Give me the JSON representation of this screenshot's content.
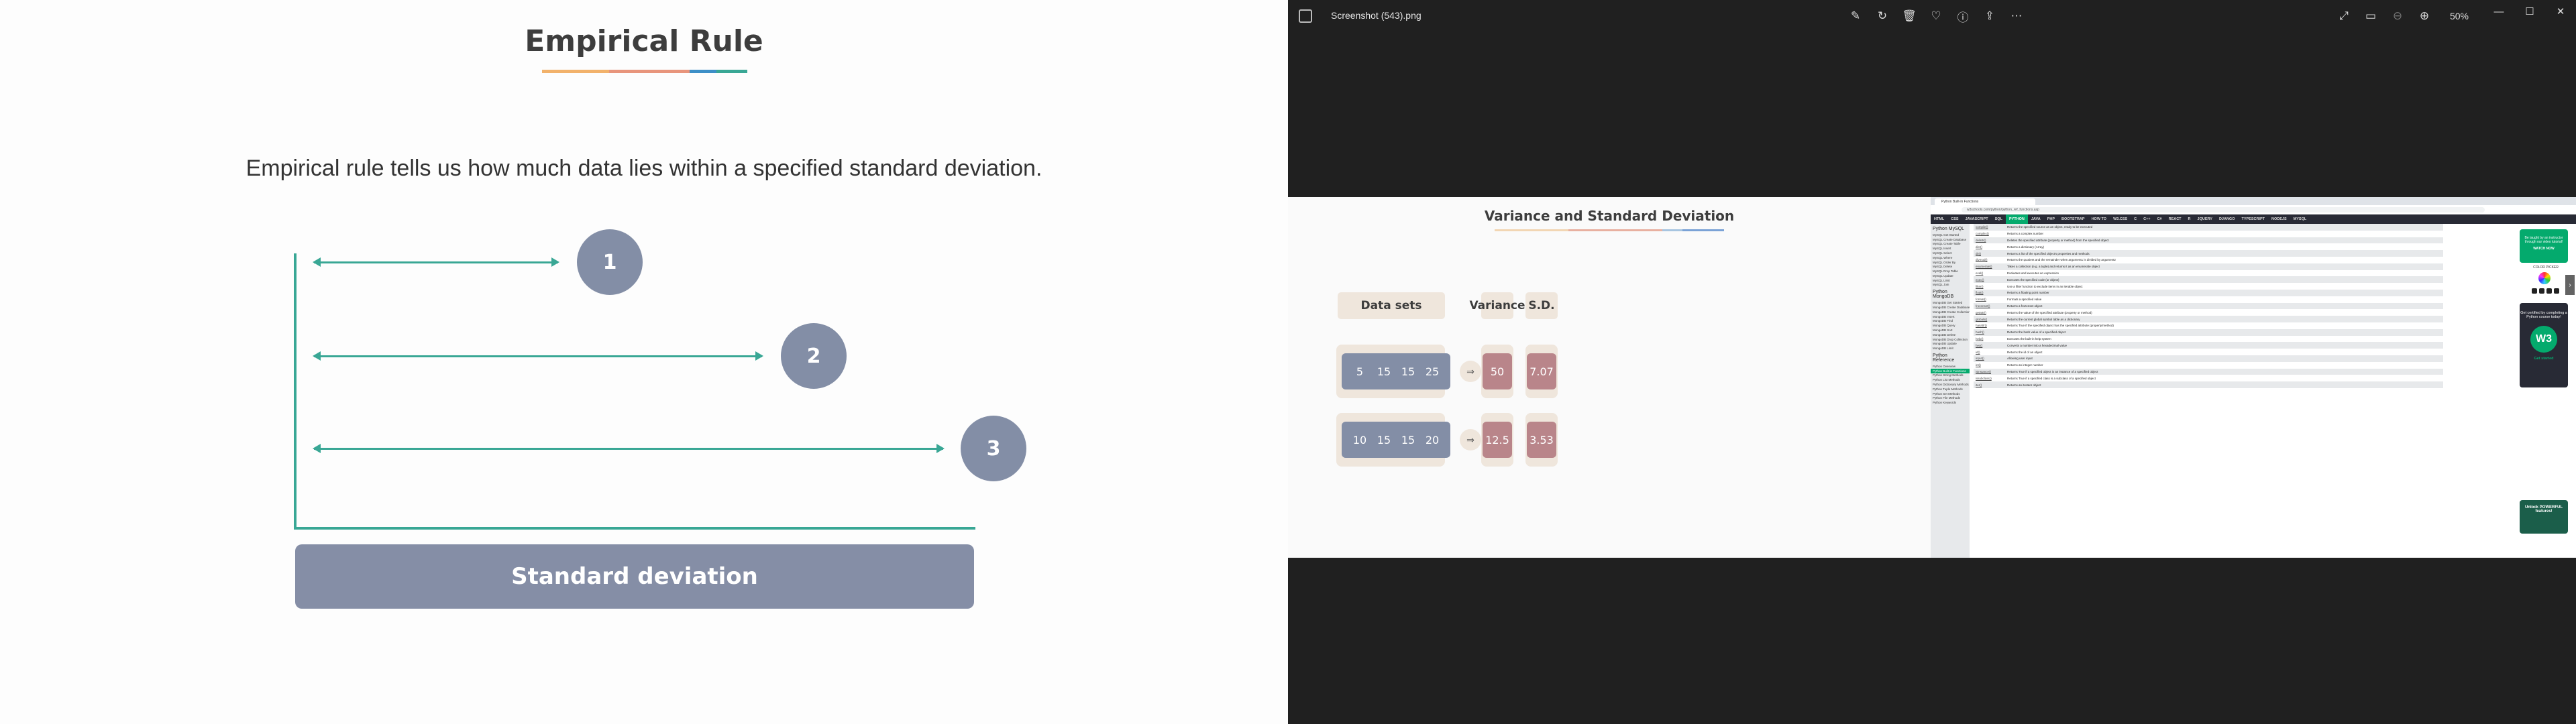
{
  "left_slide": {
    "title": "Empirical Rule",
    "subtitle": "Empirical rule tells us how much data lies within a specified standard deviation.",
    "circles": [
      "1",
      "2",
      "3"
    ],
    "box_label": "Standard deviation",
    "accent_colors": [
      "#f2b26b",
      "#e87a6c",
      "#3d8fc7",
      "#39a795"
    ]
  },
  "viewer": {
    "file_name": "Screenshot (543).png",
    "zoom": "50%",
    "toolbar_icons": [
      "edit-icon",
      "rotate-icon",
      "delete-icon",
      "favorite-icon",
      "info-icon",
      "share-icon",
      "more-icon"
    ],
    "right_icons": [
      "expand-icon",
      "slideshow-icon",
      "zoom-out-icon",
      "zoom-in-icon"
    ]
  },
  "inner_slide": {
    "title": "Variance and Standard Deviation",
    "headers": {
      "data_sets": "Data sets",
      "variance": "Variance",
      "sd": "S.D."
    },
    "rows": [
      {
        "values": [
          "5",
          "15",
          "15",
          "25"
        ],
        "arrow": "⇒",
        "variance": "50",
        "sd": "7.07"
      },
      {
        "values": [
          "10",
          "15",
          "15",
          "20"
        ],
        "arrow": "⇒",
        "variance": "12.5",
        "sd": "3.53"
      }
    ]
  },
  "browser": {
    "tab_title": "Python Built-in Functions",
    "url": "w3schools.com/python/python_ref_functions.asp",
    "nav": [
      "HTML",
      "CSS",
      "JAVASCRIPT",
      "SQL",
      "PYTHON",
      "JAVA",
      "PHP",
      "BOOTSTRAP",
      "HOW TO",
      "W3.CSS",
      "C",
      "C++",
      "C#",
      "REACT",
      "R",
      "JQUERY",
      "DJANGO",
      "TYPESCRIPT",
      "NODEJS",
      "MYSQL"
    ],
    "active_nav": "PYTHON",
    "sidebar": [
      {
        "group": "Python MySQL",
        "items": [
          "MySQL Get Started",
          "MySQL Create Database",
          "MySQL Create Table",
          "MySQL Insert",
          "MySQL Select",
          "MySQL Where",
          "MySQL Order By",
          "MySQL Delete",
          "MySQL Drop Table",
          "MySQL Update",
          "MySQL Limit",
          "MySQL Join"
        ]
      },
      {
        "group": "Python MongoDB",
        "items": [
          "MongoDB Get Started",
          "MongoDB Create Database",
          "MongoDB Create Collection",
          "MongoDB Insert",
          "MongoDB Find",
          "MongoDB Query",
          "MongoDB Sort",
          "MongoDB Delete",
          "MongoDB Drop Collection",
          "MongoDB Update",
          "MongoDB Limit"
        ]
      },
      {
        "group": "Python Reference",
        "items": [
          "Python Overview",
          "Python Built-in Functions",
          "Python String Methods",
          "Python List Methods",
          "Python Dictionary Methods",
          "Python Tuple Methods",
          "Python Set Methods",
          "Python File Methods",
          "Python Keywords"
        ]
      }
    ],
    "selected_sidebar_item": "Python Built-in Functions",
    "functions": [
      [
        "compile()",
        "Returns the specified source as an object, ready to be executed"
      ],
      [
        "complex()",
        "Returns a complex number"
      ],
      [
        "delattr()",
        "Deletes the specified attribute (property or method) from the specified object"
      ],
      [
        "dict()",
        "Returns a dictionary (Array)"
      ],
      [
        "dir()",
        "Returns a list of the specified object's properties and methods"
      ],
      [
        "divmod()",
        "Returns the quotient and the remainder when argument1 is divided by argument2"
      ],
      [
        "enumerate()",
        "Takes a collection (e.g. a tuple) and returns it as an enumerate object"
      ],
      [
        "eval()",
        "Evaluates and executes an expression"
      ],
      [
        "exec()",
        "Executes the specified code (or object)"
      ],
      [
        "filter()",
        "Use a filter function to exclude items in an iterable object"
      ],
      [
        "float()",
        "Returns a floating point number"
      ],
      [
        "format()",
        "Formats a specified value"
      ],
      [
        "frozenset()",
        "Returns a frozenset object"
      ],
      [
        "getattr()",
        "Returns the value of the specified attribute (property or method)"
      ],
      [
        "globals()",
        "Returns the current global symbol table as a dictionary"
      ],
      [
        "hasattr()",
        "Returns True if the specified object has the specified attribute (property/method)"
      ],
      [
        "hash()",
        "Returns the hash value of a specified object"
      ],
      [
        "help()",
        "Executes the built-in help system"
      ],
      [
        "hex()",
        "Converts a number into a hexadecimal value"
      ],
      [
        "id()",
        "Returns the id of an object"
      ],
      [
        "input()",
        "Allowing user input"
      ],
      [
        "int()",
        "Returns an integer number"
      ],
      [
        "isinstance()",
        "Returns True if a specified object is an instance of a specified object"
      ],
      [
        "issubclass()",
        "Returns True if a specified class is a subclass of a specified object"
      ],
      [
        "iter()",
        "Returns an iterator object"
      ]
    ],
    "ads": {
      "ad1": "Be taught by an instructor through our video tutorial!",
      "ad1_btn": "WATCH NOW",
      "picker": "COLOR PICKER",
      "ad2": "Get certified by completing a Python course today!",
      "ad2_btn": "Get started",
      "ad3": "Unlock POWERFUL features!"
    }
  }
}
